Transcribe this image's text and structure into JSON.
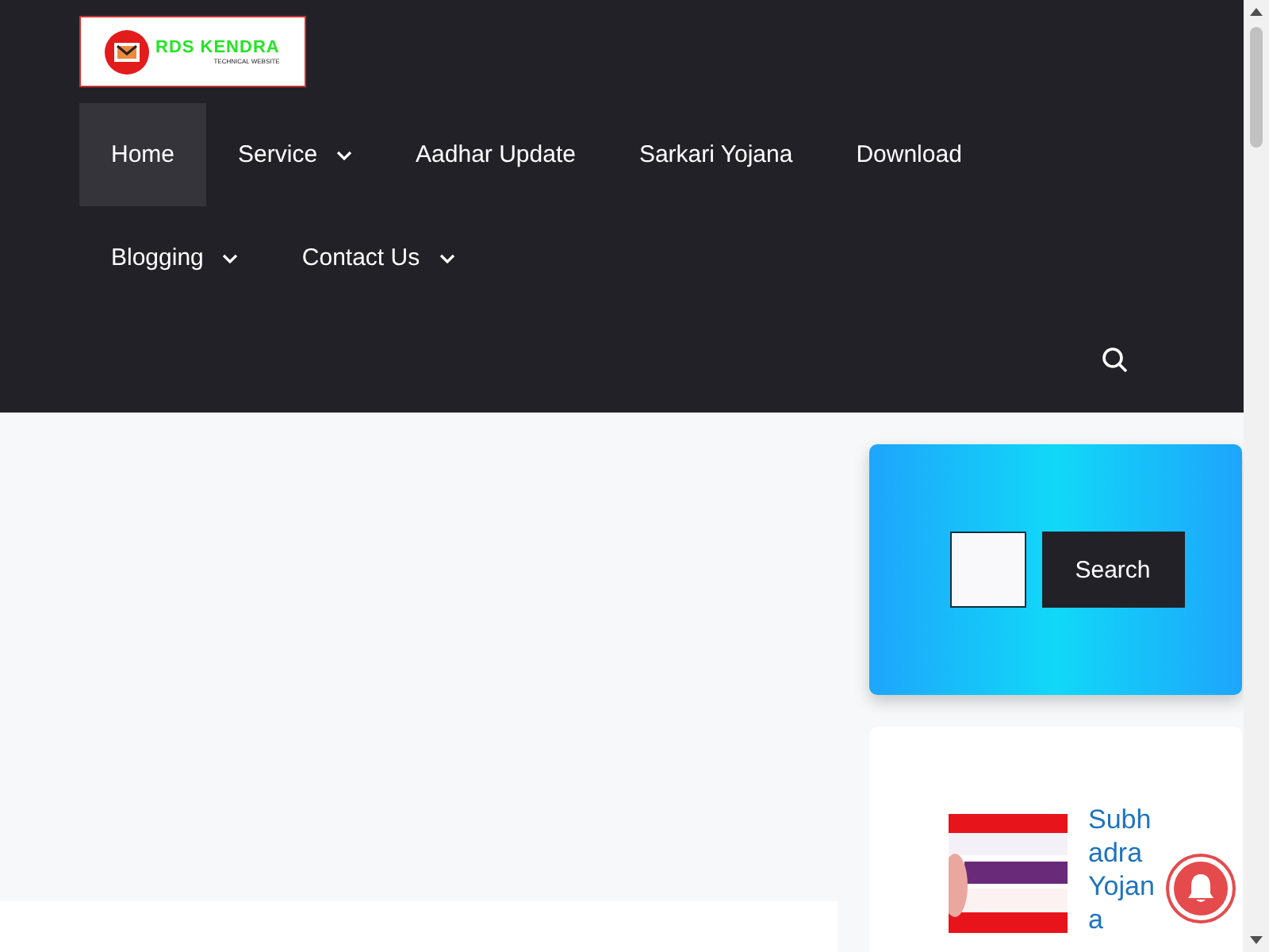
{
  "logo": {
    "title": "RDS KENDRA",
    "tagline": "TECHNICAL WEBSITE"
  },
  "nav": [
    {
      "label": "Home",
      "selected": true,
      "has_dropdown": false
    },
    {
      "label": "Service",
      "selected": false,
      "has_dropdown": true
    },
    {
      "label": "Aadhar Update",
      "selected": false,
      "has_dropdown": false
    },
    {
      "label": "Sarkari Yojana",
      "selected": false,
      "has_dropdown": false
    },
    {
      "label": "Download",
      "selected": false,
      "has_dropdown": false
    },
    {
      "label": "Blogging",
      "selected": false,
      "has_dropdown": true
    },
    {
      "label": "Contact Us",
      "selected": false,
      "has_dropdown": true
    }
  ],
  "search_widget": {
    "button": "Search"
  },
  "posts": [
    {
      "title": "Subhadra Yojana"
    }
  ]
}
